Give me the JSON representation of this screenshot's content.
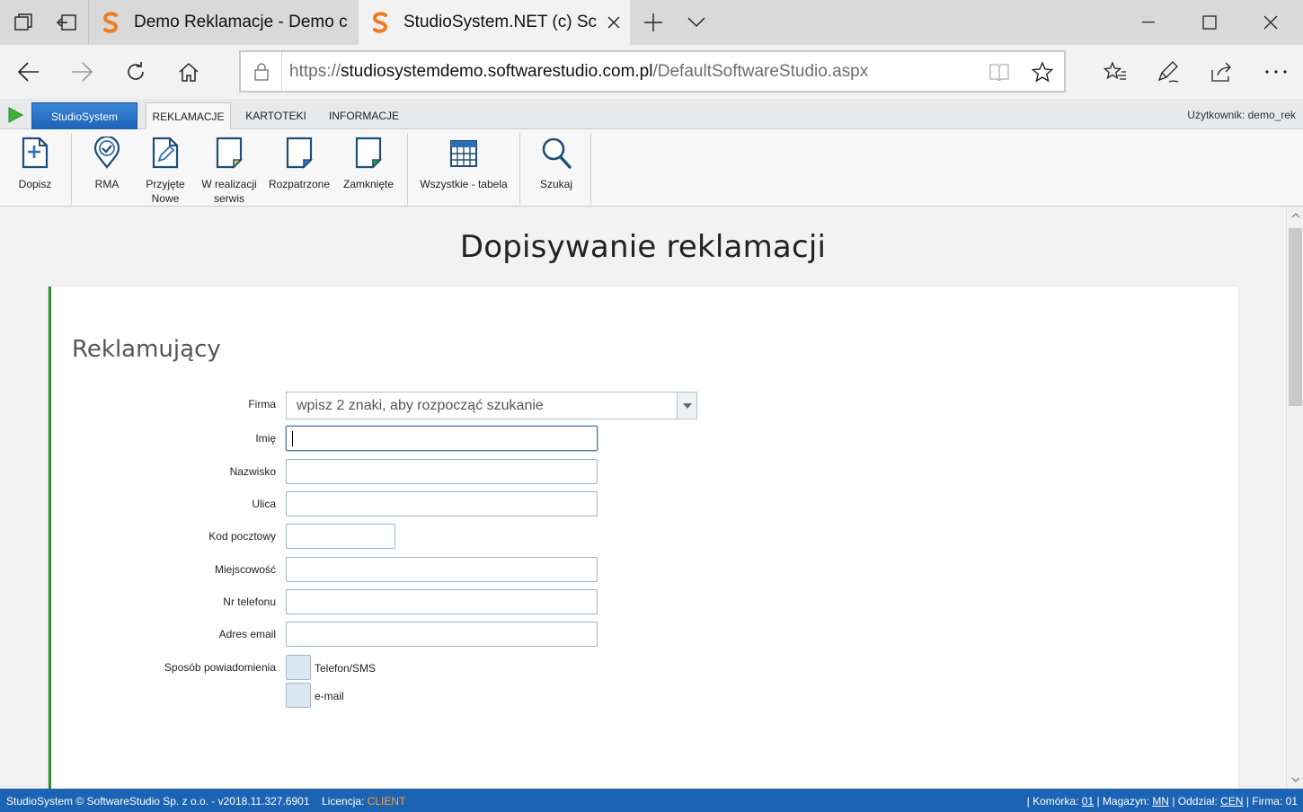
{
  "browser": {
    "tabs": [
      {
        "title": "Demo Reklamacje - Demo c"
      },
      {
        "title": "StudioSystem.NET (c) Sc"
      }
    ],
    "url_prefix": "https://",
    "url_domain": "studiosystemdemo.softwarestudio.com.pl",
    "url_path": "/DefaultSoftwareStudio.aspx"
  },
  "app": {
    "app_button": "StudioSystem",
    "menu_tabs": [
      "REKLAMACJE",
      "KARTOTEKI",
      "INFORMACJE"
    ],
    "user_label": "Użytkownik: demo_rek",
    "ribbon": [
      {
        "label": "Dopisz",
        "icon": "add-document-icon"
      },
      {
        "label": "RMA",
        "icon": "rma-badge-icon"
      },
      {
        "label": "Przyjęte\nNowe",
        "icon": "edit-document-icon"
      },
      {
        "label": "W realizacji\nserwis",
        "icon": "document-yellow-icon"
      },
      {
        "label": "Rozpatrzone",
        "icon": "document-blue-icon"
      },
      {
        "label": "Zamknięte",
        "icon": "document-green-icon"
      },
      {
        "label": "Wszystkie - tabela",
        "icon": "table-icon"
      },
      {
        "label": "Szukaj",
        "icon": "search-icon"
      }
    ]
  },
  "page": {
    "title": "Dopisywanie reklamacji",
    "section_title": "Reklamujący",
    "form": {
      "firma_label": "Firma",
      "firma_placeholder": "wpisz 2 znaki, aby rozpocząć szukanie",
      "imie_label": "Imię",
      "nazwisko_label": "Nazwisko",
      "ulica_label": "Ulica",
      "kod_label": "Kod pocztowy",
      "miejscowosc_label": "Miejscowość",
      "telefon_label": "Nr telefonu",
      "email_label": "Adres email",
      "sposob_label": "Sposób powiadomienia",
      "opt_sms": "Telefon/SMS",
      "opt_email": "e-mail"
    }
  },
  "status": {
    "left": "StudioSystem © SoftwareStudio Sp. z o.o. - v2018.11.327.6901",
    "licencja_label": "Licencja:",
    "licencja_value": "CLIENT",
    "komorka_label": "| Komórka:",
    "komorka_value": "01",
    "magazyn_label": "| Magazyn:",
    "magazyn_value": "MN",
    "oddzial_label": "| Oddział:",
    "oddzial_value": "CEN",
    "firma_label": "| Firma:",
    "firma_value": "01"
  },
  "colors": {
    "accent_green": "#2e8b2e",
    "status_blue": "#1c64b3",
    "license_orange": "#f7a23b"
  }
}
